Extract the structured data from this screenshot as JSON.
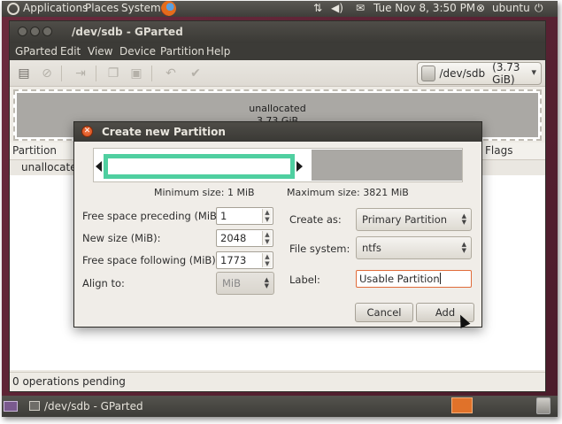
{
  "top_panel": {
    "menus": [
      "Applications",
      "Places",
      "System"
    ],
    "clock": "Tue Nov  8,  3:50 PM",
    "user": "ubuntu"
  },
  "window": {
    "title": "/dev/sdb - GParted",
    "menu": [
      "GParted",
      "Edit",
      "View",
      "Device",
      "Partition",
      "Help"
    ],
    "device": {
      "name": "/dev/sdb",
      "size": "(3.73 GiB)"
    },
    "graph": {
      "label": "unallocated",
      "size": "3.73 GiB"
    },
    "table": {
      "headers": [
        "Partition",
        "Flags"
      ],
      "rows": [
        {
          "partition": "unallocated"
        }
      ]
    },
    "status": "0 operations pending"
  },
  "dialog": {
    "title": "Create new Partition",
    "min_size": "Minimum size: 1 MiB",
    "max_size": "Maximum size: 3821 MiB",
    "fields": {
      "free_preceding": {
        "label": "Free space preceding (MiB):",
        "value": "1"
      },
      "new_size": {
        "label": "New size (MiB):",
        "value": "2048"
      },
      "free_following": {
        "label": "Free space following (MiB):",
        "value": "1773"
      },
      "align_to": {
        "label": "Align to:",
        "value": "MiB"
      },
      "create_as": {
        "label": "Create as:",
        "value": "Primary Partition"
      },
      "file_system": {
        "label": "File system:",
        "value": "ntfs"
      },
      "label": {
        "label": "Label:",
        "value": "Usable Partition"
      }
    },
    "buttons": {
      "cancel": "Cancel",
      "add": "Add"
    }
  },
  "bottom_panel": {
    "task": "/dev/sdb - GParted"
  },
  "colors": {
    "partition_highlight": "#4fcfa0",
    "unallocated": "#aaa8a4",
    "panel": "#3c3b37",
    "accent": "#e0722a"
  }
}
